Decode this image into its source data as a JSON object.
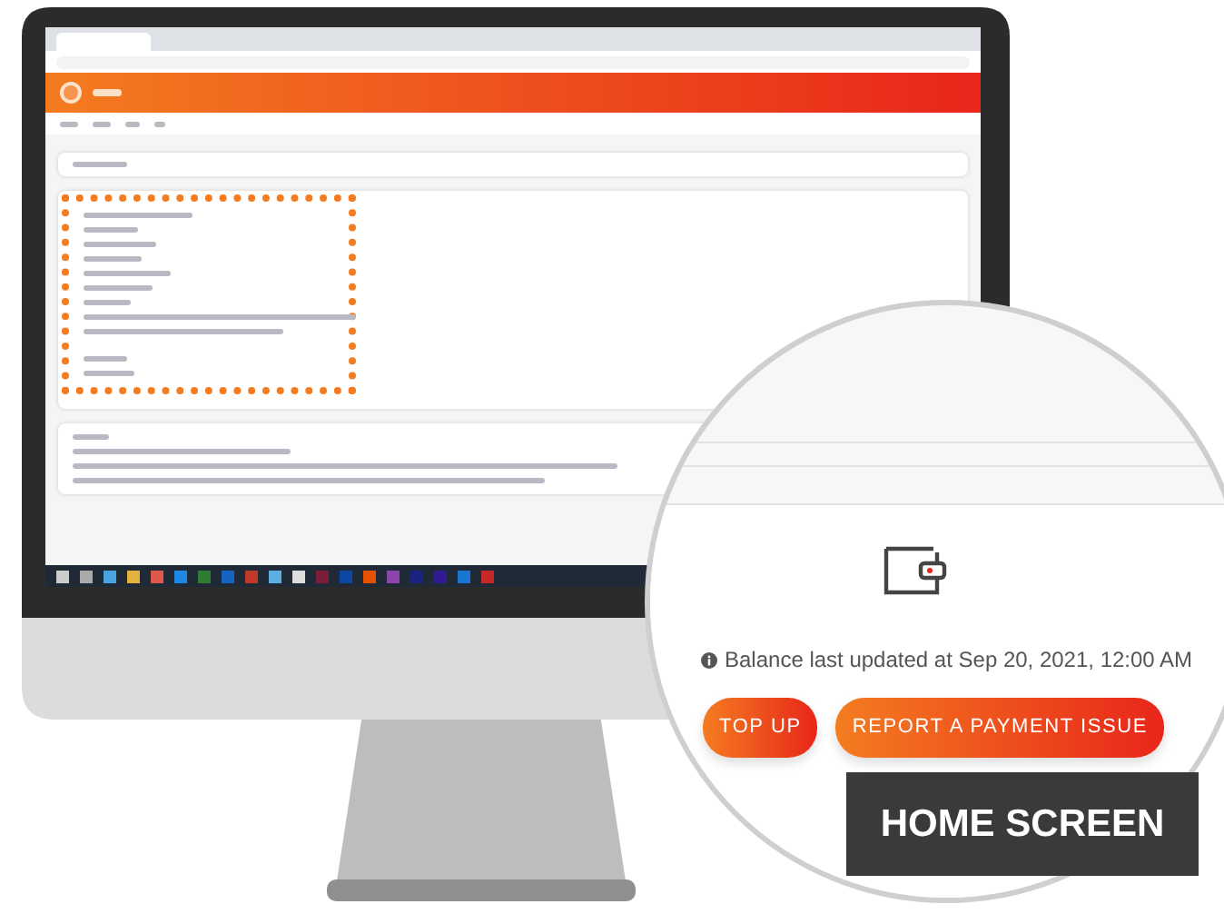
{
  "zoom_view": {
    "balance_note": "Balance last updated at Sep 20, 2021, 12:00 AM",
    "buttons": [
      {
        "label": "TOP UP"
      },
      {
        "label": "REPORT A PAYMENT ISSUE"
      }
    ]
  },
  "caption": "HOME SCREEN"
}
